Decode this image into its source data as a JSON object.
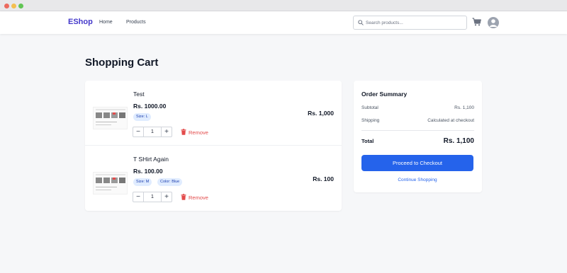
{
  "navbar": {
    "brand": "EShop",
    "links": [
      "Home",
      "Products"
    ],
    "search_placeholder": "Search products...",
    "icons": [
      "cart-icon",
      "user-avatar-icon"
    ]
  },
  "page": {
    "title": "Shopping Cart"
  },
  "cart": {
    "items": [
      {
        "name": "Test",
        "price": "Rs. 1000.00",
        "attributes": [
          "Size: L"
        ],
        "quantity": "1",
        "line_total": "Rs. 1,000",
        "remove_label": "Remove"
      },
      {
        "name": "T SHirt Again",
        "price": "Rs. 100.00",
        "attributes": [
          "Size: M",
          "Color: Blue"
        ],
        "quantity": "1",
        "line_total": "Rs. 100",
        "remove_label": "Remove"
      }
    ],
    "qty_minus": "−",
    "qty_plus": "+"
  },
  "summary": {
    "title": "Order Summary",
    "subtotal_label": "Subtotal",
    "subtotal_value": "Rs. 1,100",
    "shipping_label": "Shipping",
    "shipping_value": "Calculated at checkout",
    "total_label": "Total",
    "total_value": "Rs. 1,100",
    "checkout_label": "Proceed to Checkout",
    "continue_label": "Continue Shopping"
  },
  "colors": {
    "brand": "#4338ca",
    "primary": "#2563eb",
    "danger": "#e34b4b",
    "badge_bg": "#e0ecff"
  }
}
